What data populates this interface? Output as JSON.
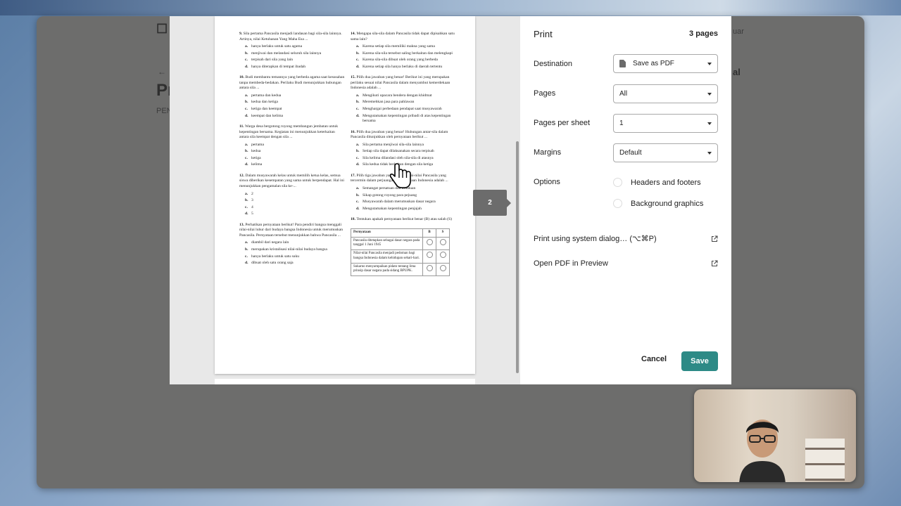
{
  "background_page": {
    "title_fragment": "Pr",
    "subtitle_fragment": "PEN",
    "right_fragment": "al",
    "top_right_fragment": "uar"
  },
  "preview": {
    "current_page_indicator": "2",
    "left_column": [
      {
        "num": "9.",
        "text": "Sila pertama Pancasila menjadi landasan bagi sila-sila lainnya. Artinya, nilai Ketuhanan Yang Maha Esa ...",
        "options": [
          [
            "a.",
            "hanya berlaku untuk satu agama"
          ],
          [
            "b.",
            "menjiwai dan melandasi seluruh sila lainnya"
          ],
          [
            "c.",
            "terpisah dari sila yang lain"
          ],
          [
            "d.",
            "hanya diterapkan di tempat ibadah"
          ]
        ]
      },
      {
        "num": "10.",
        "text": "Budi membantu temannya yang berbeda agama saat kesusahan tanpa membeda-bedakan. Perilaku Budi menunjukkan hubungan antara sila ...",
        "options": [
          [
            "a.",
            "pertama dan kedua"
          ],
          [
            "b.",
            "kedua dan ketiga"
          ],
          [
            "c.",
            "ketiga dan keempat"
          ],
          [
            "d.",
            "keempat dan kelima"
          ]
        ]
      },
      {
        "num": "11.",
        "text": "Warga desa bergotong royong membangun jembatan untuk kepentingan bersama. Kegiatan ini menunjukkan keterkaitan antara sila keempat dengan sila ...",
        "options": [
          [
            "a.",
            "pertama"
          ],
          [
            "b.",
            "kedua"
          ],
          [
            "c.",
            "ketiga"
          ],
          [
            "d.",
            "kelima"
          ]
        ]
      },
      {
        "num": "12.",
        "text": "Dalam musyawarah kelas untuk memilih ketua kelas, semua siswa diberikan kesempatan yang sama untuk berpendapat. Hal ini menunjukkan pengamalan sila ke-...",
        "options": [
          [
            "a.",
            "2"
          ],
          [
            "b.",
            "3"
          ],
          [
            "c.",
            "4"
          ],
          [
            "d.",
            "5"
          ]
        ]
      },
      {
        "num": "13.",
        "text": "Perhatikan pernyataan berikut! Para pendiri bangsa menggali nilai-nilai luhur dari budaya bangsa Indonesia untuk merumuskan Pancasila. Pernyataan tersebut menunjukkan bahwa Pancasila ...",
        "options": [
          [
            "a.",
            "diambil dari negara lain"
          ],
          [
            "b.",
            "merupakan kristalisasi nilai-nilai budaya bangsa"
          ],
          [
            "c.",
            "hanya berlaku untuk satu suku"
          ],
          [
            "d.",
            "dibuat oleh satu orang saja"
          ]
        ]
      }
    ],
    "right_column": [
      {
        "num": "14.",
        "text": "Mengapa sila-sila dalam Pancasila tidak dapat dipisahkan satu sama lain?",
        "options": [
          [
            "a.",
            "Karena setiap sila memiliki makna yang sama"
          ],
          [
            "b.",
            "Karena sila-sila tersebut saling berkaitan dan melengkapi"
          ],
          [
            "c.",
            "Karena sila-sila dibuat oleh orang yang berbeda"
          ],
          [
            "d.",
            "Karena setiap sila hanya berlaku di daerah tertentu"
          ]
        ]
      },
      {
        "num": "15.",
        "text": "Pilih dua jawaban yang benar! Berikut ini yang merupakan perilaku sesuai nilai Pancasila dalam menyambut kemerdekaan Indonesia adalah ...",
        "options": [
          [
            "a.",
            "Mengikuti upacara bendera dengan khidmat"
          ],
          [
            "b.",
            "Meremehkan jasa para pahlawan"
          ],
          [
            "c.",
            "Menghargai perbedaan pendapat saat musyawarah"
          ],
          [
            "d.",
            "Mengutamakan kepentingan pribadi di atas kepentingan bersama"
          ]
        ]
      },
      {
        "num": "16.",
        "text": "Pilih dua jawaban yang benar! Hubungan antar-sila dalam Pancasila ditunjukkan oleh pernyataan berikut ...",
        "options": [
          [
            "a.",
            "Sila pertama menjiwai sila-sila lainnya"
          ],
          [
            "b.",
            "Setiap sila dapat dilaksanakan secara terpisah"
          ],
          [
            "c.",
            "Sila kelima dilandasi oleh sila-sila di atasnya"
          ],
          [
            "d.",
            "Sila kedua tidak berkaitan dengan sila ketiga"
          ]
        ]
      },
      {
        "num": "17.",
        "text": "Pilih tiga jawaban yang benar! Nilai-nilai Pancasila yang tercermin dalam perjuangan kemerdekaan Indonesia adalah ...",
        "options": [
          [
            "a.",
            "Semangat persatuan dan kesatuan"
          ],
          [
            "b.",
            "Sikap gotong royong para pejuang"
          ],
          [
            "c.",
            "Musyawarah dalam merumuskan dasar negara"
          ],
          [
            "d.",
            "Mengutamakan kepentingan penjajah"
          ]
        ]
      },
      {
        "num": "18.",
        "text": "Tentukan apakah pernyataan berikut benar (B) atau salah (S)",
        "options": []
      }
    ],
    "table": {
      "headers": [
        "Pernyataan",
        "B",
        "S"
      ],
      "rows": [
        "Pancasila ditetapkan sebagai dasar negara pada tanggal 1 Juni 1945",
        "Nilai-nilai Pancasila menjadi pedoman bagi bangsa Indonesia dalam kehidupan sehari-hari.",
        "Sukarno menyampaikan pidato tentang lima prinsip dasar negara pada sidang BPUPK."
      ]
    }
  },
  "print": {
    "title": "Print",
    "page_count": "3 pages",
    "destination": {
      "label": "Destination",
      "value": "Save as PDF"
    },
    "pages": {
      "label": "Pages",
      "value": "All"
    },
    "pages_per_sheet": {
      "label": "Pages per sheet",
      "value": "1"
    },
    "margins": {
      "label": "Margins",
      "value": "Default"
    },
    "options": {
      "label": "Options",
      "headers_footers": "Headers and footers",
      "background_graphics": "Background graphics"
    },
    "system_dialog": "Print using system dialog… (⌥⌘P)",
    "open_preview": "Open PDF in Preview",
    "cancel": "Cancel",
    "save": "Save",
    "accent_color": "#2d8a86"
  }
}
